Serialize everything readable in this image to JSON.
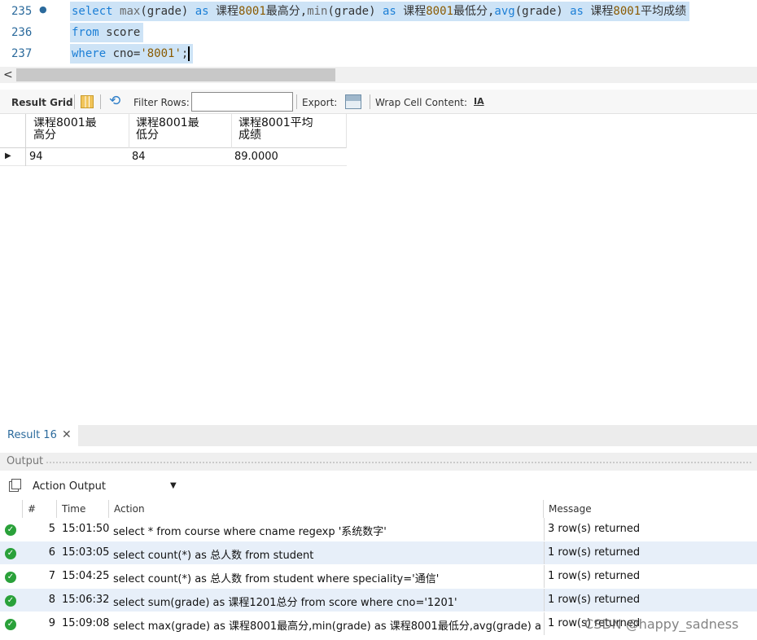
{
  "editor": {
    "lines": [
      {
        "number": "235",
        "marker": "●",
        "segments": [
          {
            "t": "select",
            "c": "kw"
          },
          {
            "t": " ",
            "c": "id"
          },
          {
            "t": "max",
            "c": "fn"
          },
          {
            "t": "(grade) ",
            "c": "id"
          },
          {
            "t": "as",
            "c": "kw"
          },
          {
            "t": " 课程",
            "c": "id"
          },
          {
            "t": "8001",
            "c": "str"
          },
          {
            "t": "最高分,",
            "c": "id"
          },
          {
            "t": "min",
            "c": "fn"
          },
          {
            "t": "(grade) ",
            "c": "id"
          },
          {
            "t": "as",
            "c": "kw"
          },
          {
            "t": " 课程",
            "c": "id"
          },
          {
            "t": "8001",
            "c": "str"
          },
          {
            "t": "最低分,",
            "c": "id"
          },
          {
            "t": "avg",
            "c": "kw"
          },
          {
            "t": "(grade) ",
            "c": "id"
          },
          {
            "t": "as",
            "c": "kw"
          },
          {
            "t": " 课程",
            "c": "id"
          },
          {
            "t": "8001",
            "c": "str"
          },
          {
            "t": "平均成绩",
            "c": "id"
          }
        ]
      },
      {
        "number": "236",
        "marker": "",
        "segments": [
          {
            "t": "from",
            "c": "kw"
          },
          {
            "t": " score",
            "c": "id"
          }
        ]
      },
      {
        "number": "237",
        "marker": "",
        "segments": [
          {
            "t": "where",
            "c": "kw"
          },
          {
            "t": " cno=",
            "c": "id"
          },
          {
            "t": "'8001'",
            "c": "str"
          },
          {
            "t": ";",
            "c": "id"
          }
        ]
      }
    ],
    "scroll_left_arrow": "<"
  },
  "grid_toolbar": {
    "result_grid": "Result Grid",
    "filter_rows": "Filter Rows:",
    "filter_value": "",
    "export": "Export:",
    "wrap_cell": "Wrap Cell Content:",
    "wrap_icon_text": "IA"
  },
  "grid": {
    "columns": [
      "课程8001最\n高分",
      "课程8001最\n低分",
      "课程8001平均\n成绩"
    ],
    "rows": [
      [
        "94",
        "84",
        "89.0000"
      ]
    ],
    "row_indicator": "▶"
  },
  "result_tab": {
    "label": "Result 16",
    "close": "✕"
  },
  "output": {
    "title": "Output",
    "mode": "Action Output",
    "headers": {
      "num": "#",
      "time": "Time",
      "action": "Action",
      "message": "Message"
    },
    "rows": [
      {
        "num": "5",
        "time": "15:01:50",
        "action": "select * from course where cname regexp '系统数字'",
        "message": "3 row(s) returned"
      },
      {
        "num": "6",
        "time": "15:03:05",
        "action": "select count(*) as 总人数 from student",
        "message": "1 row(s) returned"
      },
      {
        "num": "7",
        "time": "15:04:25",
        "action": "select count(*) as 总人数 from student where speciality='通信'",
        "message": "1 row(s) returned"
      },
      {
        "num": "8",
        "time": "15:06:32",
        "action": "select sum(grade) as 课程1201总分 from score where cno='1201'",
        "message": "1 row(s) returned"
      },
      {
        "num": "9",
        "time": "15:09:08",
        "action": "select max(grade) as 课程8001最高分,min(grade) as 课程8001最低分,avg(grade) as ...",
        "message": "1 row(s) returned"
      }
    ]
  },
  "watermark": "CSDN @happy_sadness",
  "colors": {
    "keyword": "#1c7fd6",
    "selection": "#cde3f6",
    "ok": "#2aa13a",
    "alt_row": "#e7eff9"
  }
}
